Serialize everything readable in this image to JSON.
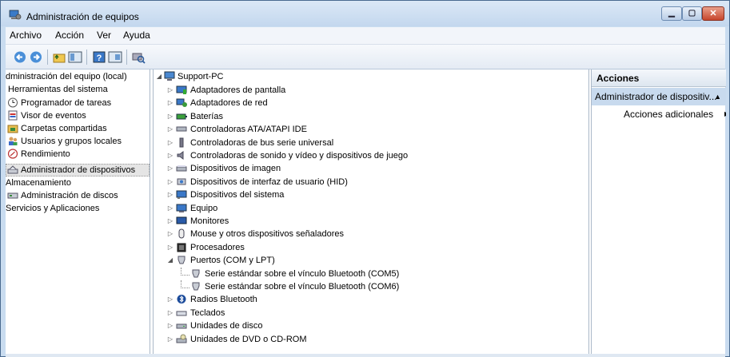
{
  "window": {
    "title": "Administración de equipos"
  },
  "menu": [
    "Archivo",
    "Acción",
    "Ver",
    "Ayuda"
  ],
  "toolbar": {
    "buttons": [
      "back-icon",
      "forward-icon",
      "up-folder-icon",
      "show-hide-tree-icon",
      "help-icon",
      "properties-icon",
      "scan-hardware-icon"
    ]
  },
  "left_tree": [
    {
      "label": "dministración del equipo (local)",
      "indent": 0,
      "icon": "computer-management-icon",
      "selected": false
    },
    {
      "label": "Herramientas del sistema",
      "indent": 1,
      "icon": "",
      "selected": false
    },
    {
      "label": "Programador de tareas",
      "indent": 1,
      "icon": "clock-icon",
      "selected": false
    },
    {
      "label": "Visor de eventos",
      "indent": 1,
      "icon": "event-viewer-icon",
      "selected": false
    },
    {
      "label": "Carpetas compartidas",
      "indent": 1,
      "icon": "shared-folder-icon",
      "selected": false
    },
    {
      "label": "Usuarios y grupos locales",
      "indent": 1,
      "icon": "users-icon",
      "selected": false
    },
    {
      "label": "Rendimiento",
      "indent": 1,
      "icon": "performance-icon",
      "selected": false
    },
    {
      "label": "Administrador de dispositivos",
      "indent": 1,
      "icon": "device-manager-icon",
      "selected": true
    },
    {
      "label": "Almacenamiento",
      "indent": 0,
      "icon": "",
      "selected": false
    },
    {
      "label": "Administración de discos",
      "indent": 1,
      "icon": "disk-management-icon",
      "selected": false
    },
    {
      "label": "Servicios y Aplicaciones",
      "indent": 0,
      "icon": "",
      "selected": false
    }
  ],
  "device_tree": {
    "root": "Support-PC",
    "categories": [
      {
        "label": "Adaptadores de pantalla",
        "icon": "display-adapter-icon"
      },
      {
        "label": "Adaptadores de red",
        "icon": "network-adapter-icon"
      },
      {
        "label": "Baterías",
        "icon": "battery-icon"
      },
      {
        "label": "Controladoras ATA/ATAPI IDE",
        "icon": "ide-controller-icon"
      },
      {
        "label": "Controladoras de bus serie universal",
        "icon": "usb-icon"
      },
      {
        "label": "Controladoras de sonido y vídeo y dispositivos de juego",
        "icon": "speaker-icon"
      },
      {
        "label": "Dispositivos de imagen",
        "icon": "scanner-icon"
      },
      {
        "label": "Dispositivos de interfaz de usuario (HID)",
        "icon": "hid-icon"
      },
      {
        "label": "Dispositivos del sistema",
        "icon": "system-devices-icon"
      },
      {
        "label": "Equipo",
        "icon": "computer-icon"
      },
      {
        "label": "Monitores",
        "icon": "monitor-icon"
      },
      {
        "label": "Mouse y otros dispositivos señaladores",
        "icon": "mouse-icon"
      },
      {
        "label": "Procesadores",
        "icon": "processor-icon"
      },
      {
        "label": "Puertos (COM y LPT)",
        "icon": "port-icon",
        "expanded": true,
        "children": [
          "Serie estándar sobre el vínculo Bluetooth (COM5)",
          "Serie estándar sobre el vínculo Bluetooth (COM6)"
        ]
      },
      {
        "label": "Radios Bluetooth",
        "icon": "bluetooth-icon"
      },
      {
        "label": "Teclados",
        "icon": "keyboard-icon"
      },
      {
        "label": "Unidades de disco",
        "icon": "disk-drive-icon"
      },
      {
        "label": "Unidades de DVD o CD-ROM",
        "icon": "dvd-drive-icon"
      }
    ]
  },
  "actions": {
    "header": "Acciones",
    "section": "Administrador de dispositiv...",
    "more": "Acciones adicionales"
  },
  "colors": {
    "selection": "#c8daee",
    "window_frame": "#c9dcf0"
  }
}
